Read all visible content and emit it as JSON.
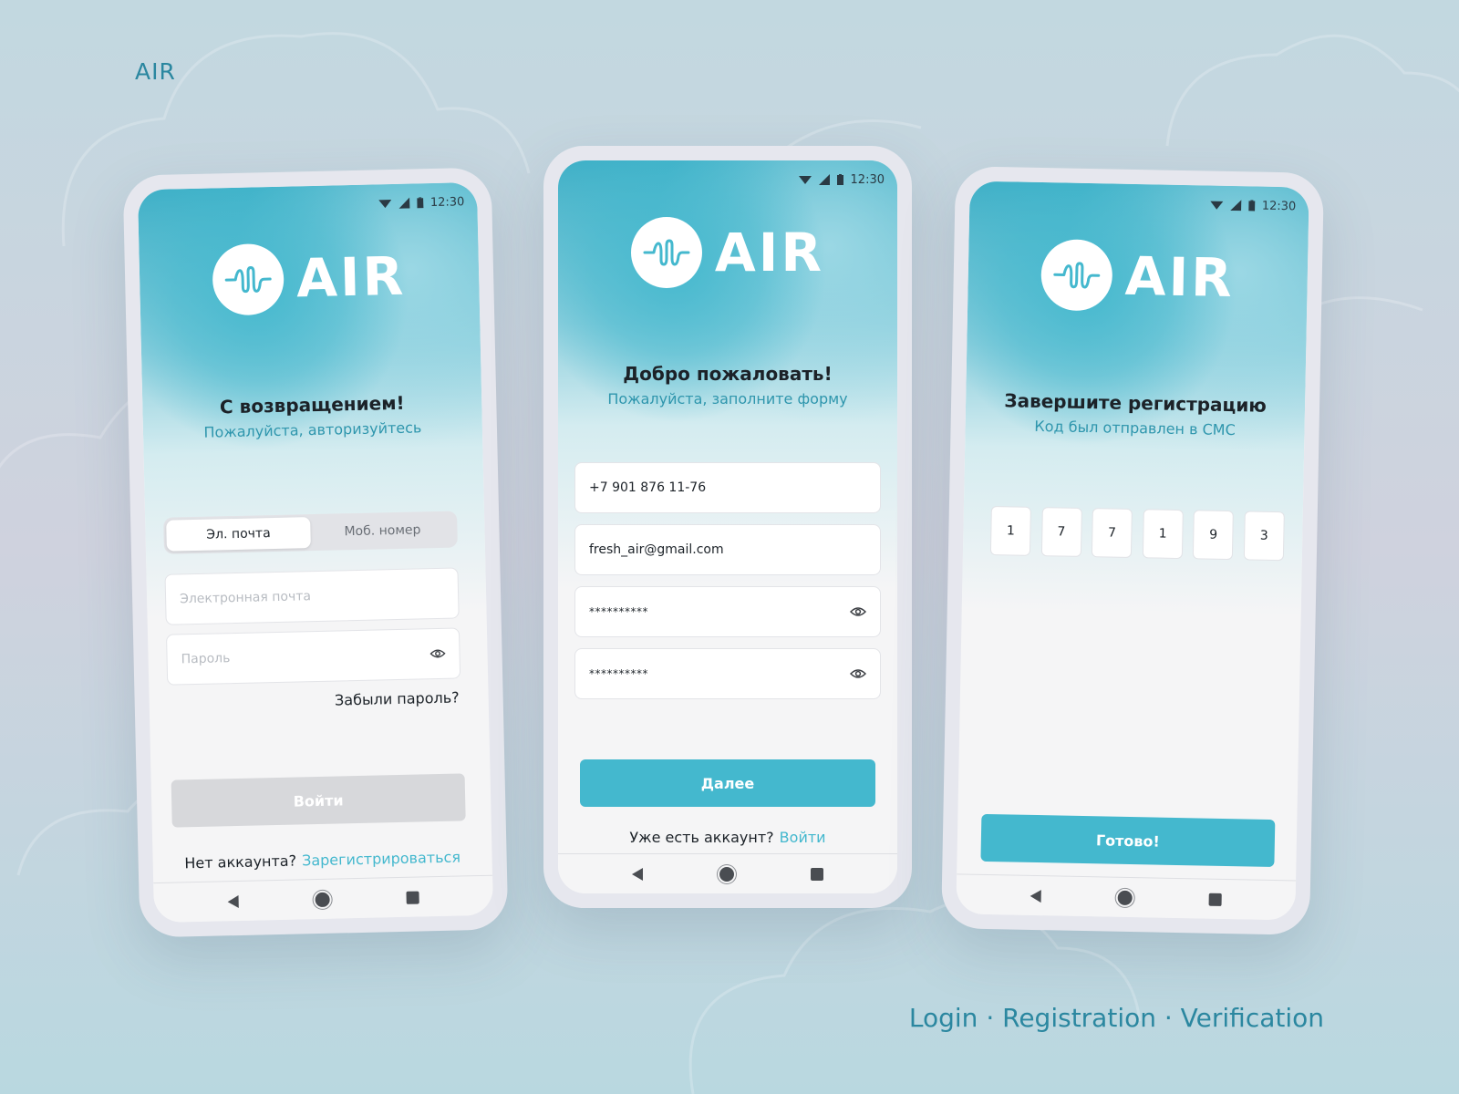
{
  "brand": "AIR",
  "caption": "Login · Registration · Verification",
  "status_time": "12:30",
  "colors": {
    "accent": "#44b8ce",
    "subtitle": "#2f96ad",
    "caption": "#2b87a0",
    "disabled_button": "#d7d8db"
  },
  "login": {
    "title": "С возвращением!",
    "subtitle": "Пожалуйста, авторизуйтесь",
    "tabs": [
      {
        "label": "Эл. почта",
        "active": true
      },
      {
        "label": "Моб. номер",
        "active": false
      }
    ],
    "email_placeholder": "Электронная почта",
    "password_placeholder": "Пароль",
    "forgot": "Забыли пароль?",
    "submit": "Войти",
    "footer_text": "Нет аккаунта?",
    "footer_link": "Зарегистрироваться"
  },
  "register": {
    "title": "Добро пожаловать!",
    "subtitle": "Пожалуйста, заполните форму",
    "phone": "+7 901 876 11-76",
    "email": "fresh_air@gmail.com",
    "password": "**********",
    "password_confirm": "**********",
    "next": "Далее",
    "footer_text": "Уже есть аккаунт?",
    "footer_link": "Войти"
  },
  "verify": {
    "title": "Завершите регистрацию",
    "subtitle": "Код был отправлен в СМС",
    "code": [
      "1",
      "7",
      "7",
      "1",
      "9",
      "3"
    ],
    "done": "Готово!"
  },
  "icons": [
    "logo-wave-icon",
    "wifi-icon",
    "signal-icon",
    "battery-icon",
    "eye-icon",
    "nav-back-icon",
    "nav-home-icon",
    "nav-recent-icon"
  ]
}
